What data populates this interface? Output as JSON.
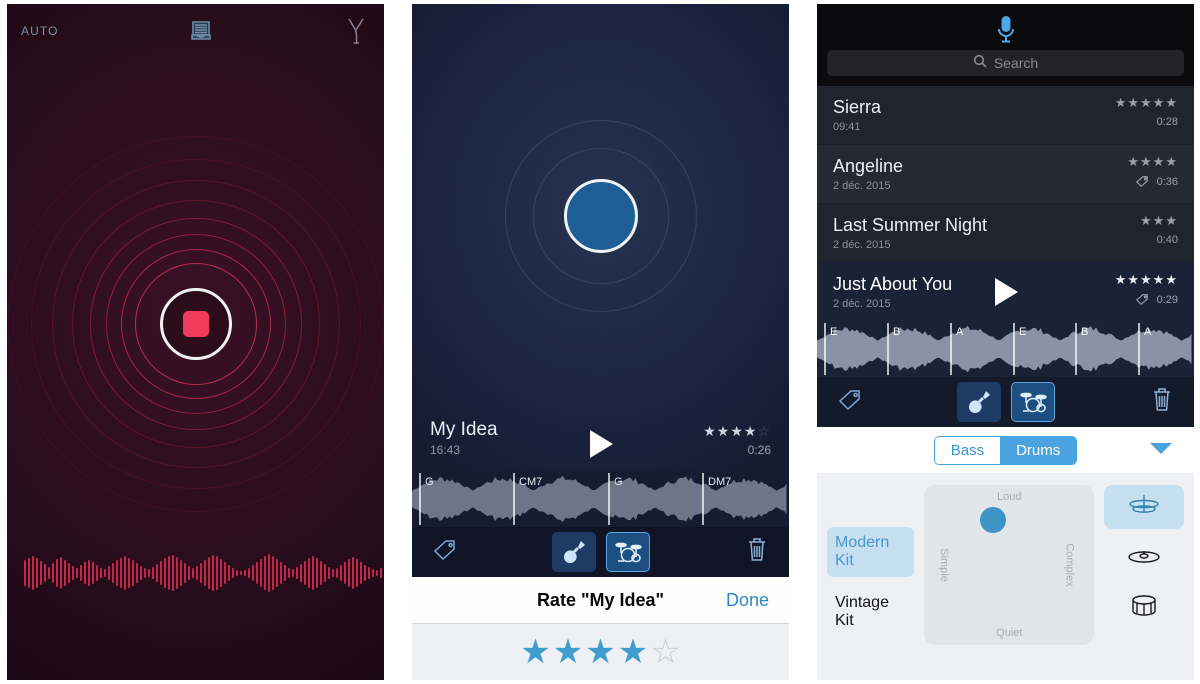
{
  "panels": {
    "recorder": {
      "auto_label": "AUTO",
      "tray_icon": "inbox-tray-icon",
      "tuning_fork_icon": "tuning-fork-icon",
      "record_button_icon": "stop-record-icon",
      "accent_color": "#f23a5c",
      "background_color": "#2b0e1c",
      "waveform_heights": [
        26,
        30,
        34,
        30,
        24,
        18,
        12,
        20,
        28,
        32,
        26,
        20,
        14,
        10,
        16,
        22,
        26,
        22,
        16,
        10,
        8,
        14,
        20,
        26,
        30,
        34,
        30,
        26,
        20,
        14,
        10,
        8,
        12,
        18,
        24,
        30,
        34,
        36,
        32,
        26,
        20,
        14,
        10,
        14,
        20,
        26,
        32,
        36,
        34,
        28,
        22,
        16,
        10,
        6,
        4,
        6,
        10,
        16,
        22,
        28,
        34,
        38,
        34,
        28,
        22,
        16,
        10,
        8,
        12,
        18,
        24,
        30,
        34,
        30,
        24,
        18,
        12,
        8,
        10,
        16,
        22,
        28,
        32,
        28,
        22,
        16,
        12,
        8,
        6,
        10
      ]
    },
    "player": {
      "play_circle_icon": "record-blue-circle-icon",
      "background_color": "#1b2540",
      "track": {
        "title": "My Idea",
        "time": "16:43",
        "duration": "0:26",
        "rating": 4,
        "rating_max": 5,
        "play_icon": "play-icon",
        "chords": [
          "G",
          "CM7",
          "G",
          "DM7"
        ]
      },
      "toolbar": {
        "tag_icon": "tag-icon",
        "guitar_icon": "guitar-icon",
        "drums_icon": "drums-icon",
        "trash_icon": "trash-icon",
        "active_instrument": "drums"
      },
      "rate_dialog": {
        "title": "Rate \"My Idea\"",
        "done_label": "Done",
        "rating": 4,
        "rating_max": 5
      }
    },
    "library": {
      "mic_icon": "microphone-icon",
      "search": {
        "placeholder": "Search",
        "icon": "search-icon",
        "value": ""
      },
      "recordings": [
        {
          "name": "Sierra",
          "date": "09:41",
          "rating": 5,
          "duration": "0:28",
          "has_tag": false,
          "selected": false
        },
        {
          "name": "Angeline",
          "date": "2 déc. 2015",
          "rating": 4,
          "duration": "0:36",
          "has_tag": true,
          "selected": false
        },
        {
          "name": "Last Summer Night",
          "date": "2 déc. 2015",
          "rating": 3,
          "duration": "0:40",
          "has_tag": false,
          "selected": false
        },
        {
          "name": "Just About You",
          "date": "2 déc. 2015",
          "rating": 5,
          "duration": "0:29",
          "has_tag": true,
          "selected": true
        }
      ],
      "selected_chords": [
        "E",
        "B",
        "A",
        "E",
        "B",
        "A"
      ],
      "toolbar": {
        "tag_icon": "tag-icon",
        "guitar_icon": "guitar-icon",
        "drums_icon": "drums-icon",
        "trash_icon": "trash-icon",
        "active_instrument": "drums"
      },
      "segmented": {
        "options": [
          "Bass",
          "Drums"
        ],
        "selected": "Drums",
        "collapse_icon": "chevron-down-icon",
        "accent_color": "#4aa3df"
      },
      "kits": [
        {
          "label": "Modern Kit",
          "selected": true
        },
        {
          "label": "Vintage Kit",
          "selected": false
        }
      ],
      "xy_pad": {
        "top_label": "Loud",
        "bottom_label": "Quiet",
        "left_label": "Simple",
        "right_label": "Complex",
        "dot_color": "#3d94c6"
      },
      "drum_pieces": [
        {
          "icon": "hihat-icon",
          "selected": true
        },
        {
          "icon": "cymbal-icon",
          "selected": false
        },
        {
          "icon": "snare-drum-icon",
          "selected": false
        }
      ]
    }
  }
}
